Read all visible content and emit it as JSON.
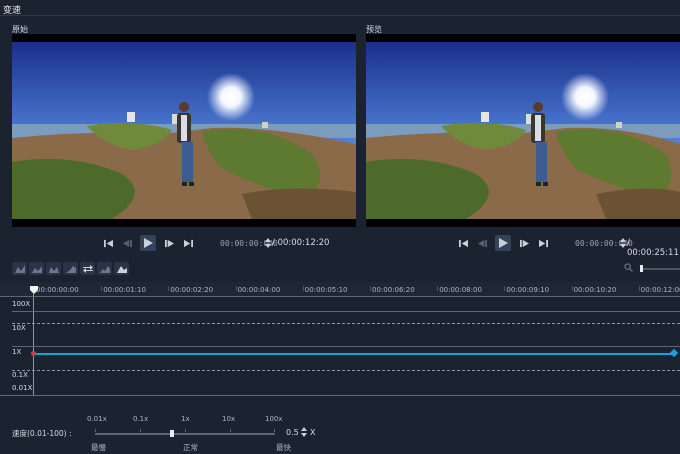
{
  "window": {
    "title": "变速"
  },
  "original": {
    "label": "原始",
    "timecode_input": "00:00:00:000",
    "duration": "/ 00:00:12:20"
  },
  "preview": {
    "label": "预览",
    "timecode_input": "00:00:00:000",
    "duration": "/ 00:00:25:11"
  },
  "ruler": {
    "ticks": [
      "00:00:00:00",
      "00:00:01:10",
      "00:00:02:20",
      "00:00:04:00",
      "00:00:05:10",
      "00:00:06:20",
      "00:00:08:00",
      "00:00:09:10",
      "00:00:10:20",
      "00:00:12:00"
    ]
  },
  "graph": {
    "y_labels": [
      "100X",
      "10X",
      "1X",
      "0.1X",
      "0.01X"
    ],
    "speed_line_color": "#1e9fd6",
    "start_keyframe_color": "#e0383e",
    "end_keyframe_color": "#1e9fd6"
  },
  "speed": {
    "label": "速度(0.01-100) :",
    "marks": [
      "0.01x",
      "0.1x",
      "1x",
      "10x",
      "100x"
    ],
    "captions": {
      "slowest": "最慢",
      "normal": "正常",
      "fastest": "最快"
    },
    "value": "0.5",
    "unit": "X"
  },
  "toolbar": {
    "icons": [
      "keyframe-add-icon",
      "keyframe-remove-icon",
      "keyframe-prev-icon",
      "keyframe-next-icon",
      "swap-icon",
      "keyframe-reset-icon",
      "speed-curve-icon"
    ]
  },
  "zoom": {
    "icon": "zoom-out-icon"
  }
}
